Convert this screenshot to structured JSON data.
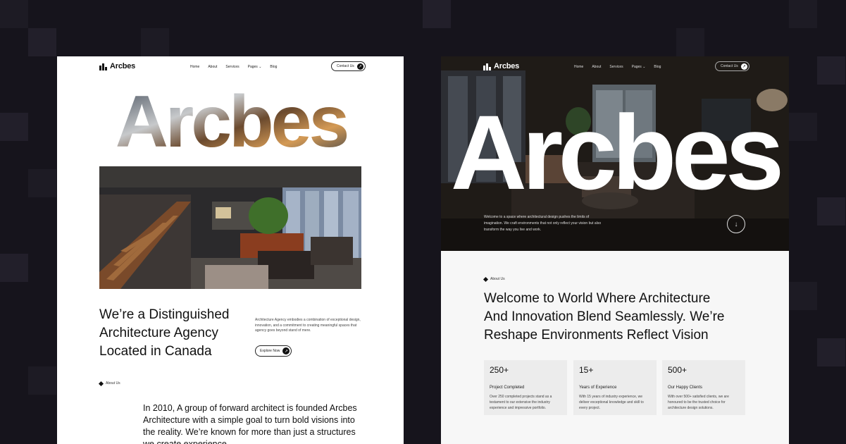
{
  "brand": "Arcbes",
  "nav": [
    "Home",
    "About",
    "Services",
    "Pages",
    "Blog"
  ],
  "contact_label": "Contact Us",
  "left": {
    "hero_word": "Arcbes",
    "headline": [
      "We’re a Distinguished",
      "Architecture Agency",
      "Located in Canada"
    ],
    "description": "Architecture Agency embodies a combination of exceptional design, innovation, and a commitment to creating meaningful spaces that agency goes beyond stand of mere.",
    "explore_label": "Explore Now",
    "about_tag": "About Us",
    "story": "In 2010, A group of forward architect is founded Arcbes Architecture with a simple goal to turn bold visions into the reality. We’re known for more than just a structures we create experience."
  },
  "right": {
    "hero_word": "Arcbes",
    "hero_text": "Welcome to a space where architectural design pushes the limits of imagination. We craft environments that not only reflect your vision but also transform the way you live and work.",
    "about_tag": "About Us",
    "headline": [
      "Welcome to World Where Architecture",
      "And Innovation Blend Seamlessly. We’re",
      "Reshape Environments Reflect Vision"
    ],
    "stats": [
      {
        "number": "250+",
        "label": "Project Completed",
        "text": "Over 250 completed projects stand as a testament to our extensive the industry experience and impressive portfolio."
      },
      {
        "number": "15+",
        "label": "Years of Experience",
        "text": "With 15 years of industry experience, we deliver exceptional knowledge and skill to every project."
      },
      {
        "number": "500+",
        "label": "Our Happy Clients",
        "text": "With over 500+ satisfied clients, we are honoured to be the trusted choice for architecture design solutions."
      }
    ]
  },
  "colors": {
    "background": "#16141c",
    "dark_card": "#1e1b17",
    "accent": "#111111"
  },
  "icons": [
    "building-logo-icon",
    "chevron-down-icon",
    "arrow-up-right-icon",
    "arrow-down-icon",
    "diamond-icon"
  ]
}
